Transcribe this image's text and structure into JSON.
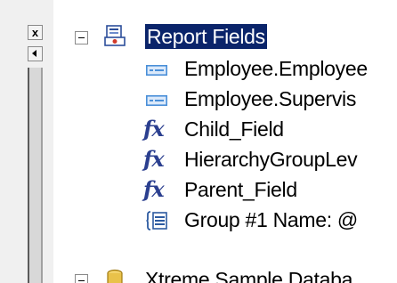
{
  "toolbar": {
    "close_glyph": "x"
  },
  "tree": {
    "root_label": "Report Fields",
    "items": [
      {
        "label": "Employee.Employee",
        "icon": "database-field-icon"
      },
      {
        "label": "Employee.Supervis",
        "icon": "database-field-icon"
      },
      {
        "label": "Child_Field",
        "icon": "formula-icon",
        "icon_text": "fx"
      },
      {
        "label": "HierarchyGroupLev",
        "icon": "formula-icon",
        "icon_text": "fx"
      },
      {
        "label": "Parent_Field",
        "icon": "formula-icon",
        "icon_text": "fx"
      },
      {
        "label": "Group #1 Name: @",
        "icon": "group-name-icon"
      }
    ],
    "next_root_label": "Xtreme Sample Databa"
  },
  "colors": {
    "selection": "#0a246a",
    "field_icon": "#4a8fd8",
    "formula_icon": "#2b3f8f",
    "group_icon": "#2c5aa0"
  }
}
